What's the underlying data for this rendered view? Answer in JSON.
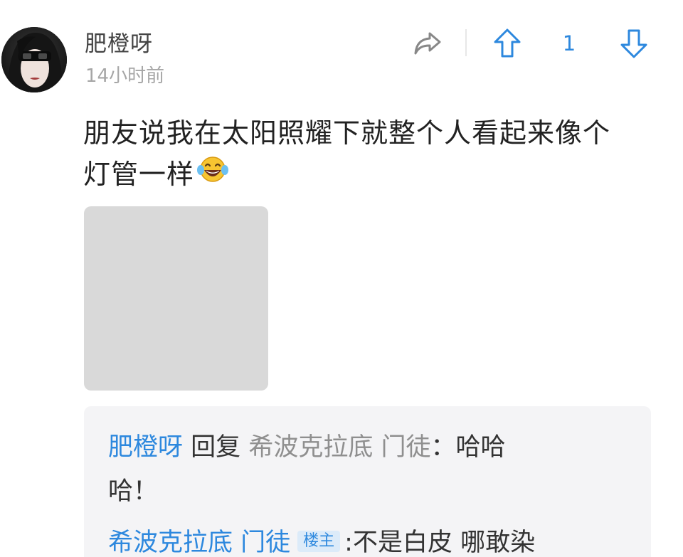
{
  "post": {
    "author": "肥橙呀",
    "time": "14小时前",
    "vote_count": "1",
    "text_line1": "朋友说我在太阳照耀下就整个人看起来像个",
    "text_line2": "灯管一样",
    "emoji_icon": "tears-of-joy-emoji"
  },
  "replies": [
    {
      "author": "肥橙呀",
      "action": "回复",
      "target": "希波克拉底 门徒",
      "separator": "：",
      "text_line1": "哈哈",
      "text_line2": "哈！"
    },
    {
      "author": "希波克拉底 门徒",
      "badge": "楼主",
      "separator": ":",
      "text": "不是白皮 哪敢染"
    }
  ],
  "colors": {
    "accent": "#2d88de",
    "muted": "#a6a6a6",
    "reply_background": "#f4f4f6",
    "image_placeholder": "#d9d9d9"
  }
}
